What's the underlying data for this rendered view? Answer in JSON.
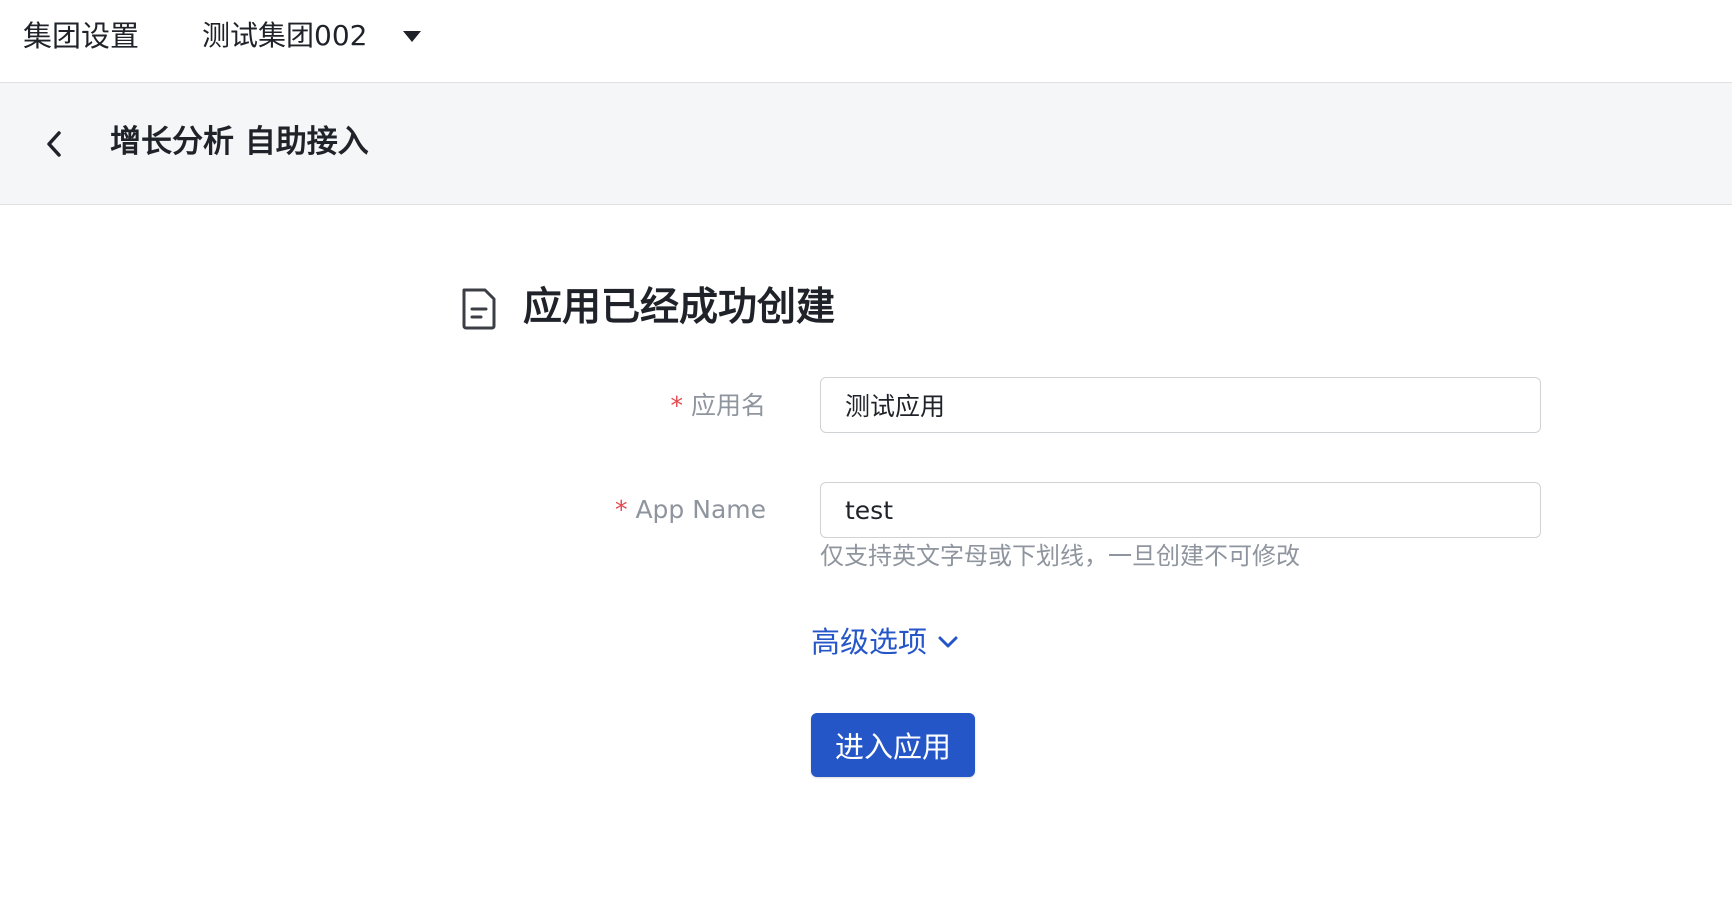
{
  "topbar": {
    "title": "集团设置",
    "group_name": "测试集团002"
  },
  "subheader": {
    "title": "增长分析 自助接入"
  },
  "main": {
    "success_title": "应用已经成功创建",
    "fields": [
      {
        "label": "应用名",
        "value": "测试应用",
        "required": "*"
      },
      {
        "label": "App Name",
        "value": "test",
        "required": "*",
        "hint": "仅支持英文字母或下划线，一旦创建不可修改"
      }
    ],
    "advanced_label": "高级选项",
    "submit_label": "进入应用"
  },
  "colors": {
    "accent": "#2456c8",
    "required": "#e5484d",
    "muted_text": "#8f959e",
    "subheader_bg": "#f5f6f7"
  },
  "icons": [
    "chevron-left-icon",
    "caret-down-icon",
    "document-icon",
    "chevron-down-icon"
  ]
}
